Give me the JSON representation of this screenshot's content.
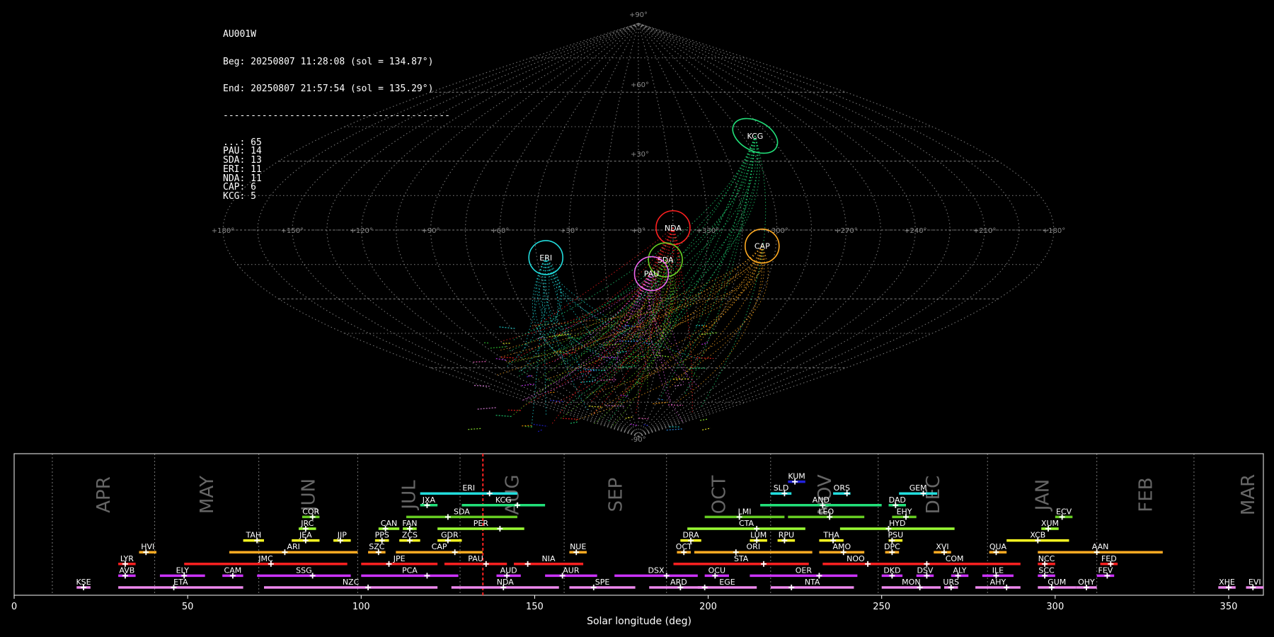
{
  "stats": {
    "station": "AU001W",
    "beg": "Beg: 20250807 11:28:08 (sol = 134.87°)",
    "end": "End: 20250807 21:57:54 (sol = 135.29°)",
    "separator": "-----------------------------------------",
    "counts": [
      {
        "label": "...",
        "value": 65
      },
      {
        "label": "PAU",
        "value": 14
      },
      {
        "label": "SDA",
        "value": 13
      },
      {
        "label": "ERI",
        "value": 11
      },
      {
        "label": "NDA",
        "value": 11
      },
      {
        "label": "CAP",
        "value": 6
      },
      {
        "label": "KCG",
        "value": 5
      }
    ]
  },
  "colors": {
    "grid": "#8a8a8a",
    "frame": "#cfcfcf",
    "month_text": "#666666",
    "current_line": "#ff2020",
    "stream_palette": [
      "#ff2020",
      "#ff9900",
      "#ffff22",
      "#99ff33",
      "#33cc33",
      "#22e07a",
      "#22dddd",
      "#3399ff",
      "#2222dd",
      "#cc33ff",
      "#ff66cc",
      "#ee88ee"
    ]
  },
  "sky_map": {
    "projection": "sinusoidal",
    "lon_ticks": [
      "+180°",
      "+150°",
      "+120°",
      "+90°",
      "+60°",
      "+30°",
      "+0°",
      "+330°",
      "+300°",
      "+270°",
      "+240°",
      "+210°",
      "+180°"
    ],
    "lat_ticks": [
      "+90°",
      "+60°",
      "+30°",
      "-90°"
    ],
    "radiants": [
      {
        "code": "ERI",
        "lon": 41,
        "lat": -12,
        "color": "#22dddd"
      },
      {
        "code": "NDA",
        "lon": 345,
        "lat": 1,
        "color": "#ff2020"
      },
      {
        "code": "SDA",
        "lon": 348,
        "lat": -13,
        "color": "#66cc22"
      },
      {
        "code": "PAU",
        "lon": 354,
        "lat": -19,
        "color": "#ee66ee"
      },
      {
        "code": "CAP",
        "lon": 306,
        "lat": -7,
        "color": "#ffaa22"
      },
      {
        "code": "KCG",
        "lon": 293,
        "lat": 41,
        "color": "#22e07a"
      }
    ]
  },
  "chart_data": {
    "type": "timeline",
    "xlabel": "Solar longitude (deg)",
    "xlim": [
      0,
      360
    ],
    "xticks": [
      0,
      50,
      100,
      150,
      200,
      250,
      300,
      350
    ],
    "current_sol": 135.08,
    "months": [
      {
        "name": "APR",
        "start": 11,
        "end": 40.5
      },
      {
        "name": "MAY",
        "start": 40.5,
        "end": 70.5
      },
      {
        "name": "JUN",
        "start": 70.5,
        "end": 99
      },
      {
        "name": "JUL",
        "start": 99,
        "end": 128.5
      },
      {
        "name": "AUG",
        "start": 128.5,
        "end": 158.5
      },
      {
        "name": "SEP",
        "start": 158.5,
        "end": 188
      },
      {
        "name": "OCT",
        "start": 188,
        "end": 218
      },
      {
        "name": "NOV",
        "start": 218,
        "end": 249
      },
      {
        "name": "DEC",
        "start": 249,
        "end": 280.5
      },
      {
        "name": "JAN",
        "start": 280.5,
        "end": 312
      },
      {
        "name": "FEB",
        "start": 312,
        "end": 340
      },
      {
        "name": "MAR",
        "start": 340,
        "end": 371
      }
    ],
    "streams": [
      {
        "code": "KUM",
        "row": 10,
        "start": 223,
        "end": 228,
        "peak": 225,
        "color": "#2222dd"
      },
      {
        "code": "ERI",
        "row": 9,
        "start": 117,
        "end": 145,
        "peak": 137,
        "color": "#22dddd"
      },
      {
        "code": "SLD",
        "row": 9,
        "start": 218,
        "end": 224,
        "peak": 222,
        "color": "#22dddd"
      },
      {
        "code": "ORS",
        "row": 9,
        "start": 236,
        "end": 241,
        "peak": 240,
        "color": "#22dddd"
      },
      {
        "code": "GEM",
        "row": 9,
        "start": 255,
        "end": 266,
        "peak": 262,
        "color": "#22dddd"
      },
      {
        "code": "JXA",
        "row": 8,
        "start": 117,
        "end": 122,
        "peak": 119,
        "color": "#22e07a"
      },
      {
        "code": "KCG",
        "row": 8,
        "start": 129,
        "end": 153,
        "peak": 145,
        "color": "#22e07a"
      },
      {
        "code": "AND",
        "row": 8,
        "start": 215,
        "end": 250,
        "peak": 233,
        "color": "#22e07a"
      },
      {
        "code": "DAD",
        "row": 8,
        "start": 252,
        "end": 257,
        "peak": 254,
        "color": "#22e07a"
      },
      {
        "code": "COR",
        "row": 7,
        "start": 83,
        "end": 88,
        "peak": 86,
        "color": "#66cc22"
      },
      {
        "code": "SDA",
        "row": 7,
        "start": 113,
        "end": 145,
        "peak": 125,
        "color": "#66cc22"
      },
      {
        "code": "LMI",
        "row": 7,
        "start": 199,
        "end": 222,
        "peak": 209,
        "color": "#66cc22"
      },
      {
        "code": "LEO",
        "row": 7,
        "start": 223,
        "end": 245,
        "peak": 235,
        "color": "#66cc22"
      },
      {
        "code": "EHY",
        "row": 7,
        "start": 253,
        "end": 260,
        "peak": 257,
        "color": "#66cc22"
      },
      {
        "code": "ECV",
        "row": 7,
        "start": 300,
        "end": 305,
        "peak": 302,
        "color": "#66cc22"
      },
      {
        "code": "JRC",
        "row": 6,
        "start": 82,
        "end": 87,
        "peak": 84,
        "color": "#99ff33"
      },
      {
        "code": "CAN",
        "row": 6,
        "start": 105,
        "end": 111,
        "peak": 107,
        "color": "#99ff33"
      },
      {
        "code": "FAN",
        "row": 6,
        "start": 112,
        "end": 116,
        "peak": 114,
        "color": "#99ff33"
      },
      {
        "code": "PER",
        "row": 6,
        "start": 122,
        "end": 147,
        "peak": 140,
        "color": "#99ff33"
      },
      {
        "code": "CTA",
        "row": 6,
        "start": 194,
        "end": 228,
        "peak": 214,
        "color": "#99ff33"
      },
      {
        "code": "HYD",
        "row": 6,
        "start": 238,
        "end": 271,
        "peak": 252,
        "color": "#99ff33"
      },
      {
        "code": "XUM",
        "row": 6,
        "start": 296,
        "end": 301,
        "peak": 298,
        "color": "#99ff33"
      },
      {
        "code": "TAH",
        "row": 5,
        "start": 66,
        "end": 72,
        "peak": 70,
        "color": "#ffff22"
      },
      {
        "code": "JEA",
        "row": 5,
        "start": 80,
        "end": 88,
        "peak": 84,
        "color": "#ffff22"
      },
      {
        "code": "JIP",
        "row": 5,
        "start": 92,
        "end": 97,
        "peak": 94,
        "color": "#ffff22"
      },
      {
        "code": "PPS",
        "row": 5,
        "start": 104,
        "end": 108,
        "peak": 106,
        "color": "#ffff22"
      },
      {
        "code": "ZCS",
        "row": 5,
        "start": 111,
        "end": 117,
        "peak": 114,
        "color": "#ffff22"
      },
      {
        "code": "GDR",
        "row": 5,
        "start": 122,
        "end": 129,
        "peak": 125,
        "color": "#ffff22"
      },
      {
        "code": "DRA",
        "row": 5,
        "start": 192,
        "end": 198,
        "peak": 195,
        "color": "#ffff22"
      },
      {
        "code": "LUM",
        "row": 5,
        "start": 212,
        "end": 217,
        "peak": 214,
        "color": "#ffff22"
      },
      {
        "code": "RPU",
        "row": 5,
        "start": 220,
        "end": 225,
        "peak": 222,
        "color": "#ffff22"
      },
      {
        "code": "THA",
        "row": 5,
        "start": 232,
        "end": 239,
        "peak": 236,
        "color": "#ffff22"
      },
      {
        "code": "PSU",
        "row": 5,
        "start": 252,
        "end": 256,
        "peak": 253,
        "color": "#ffff22"
      },
      {
        "code": "XCB",
        "row": 5,
        "start": 286,
        "end": 304,
        "peak": 295,
        "color": "#ffff22"
      },
      {
        "code": "HVI",
        "row": 4,
        "start": 36,
        "end": 41,
        "peak": 38,
        "color": "#ffaa22"
      },
      {
        "code": "ARI",
        "row": 4,
        "start": 62,
        "end": 99,
        "peak": 78,
        "color": "#ffaa22"
      },
      {
        "code": "SZC",
        "row": 4,
        "start": 102,
        "end": 107,
        "peak": 105,
        "color": "#ffaa22"
      },
      {
        "code": "CAP",
        "row": 4,
        "start": 110,
        "end": 135,
        "peak": 127,
        "color": "#ffaa22"
      },
      {
        "code": "NUE",
        "row": 4,
        "start": 160,
        "end": 165,
        "peak": 162,
        "color": "#ffaa22"
      },
      {
        "code": "OCT",
        "row": 4,
        "start": 191,
        "end": 195,
        "peak": 193,
        "color": "#ffaa22"
      },
      {
        "code": "ORI",
        "row": 4,
        "start": 196,
        "end": 230,
        "peak": 208,
        "color": "#ffaa22"
      },
      {
        "code": "AMO",
        "row": 4,
        "start": 232,
        "end": 245,
        "peak": 239,
        "color": "#ffaa22"
      },
      {
        "code": "DPC",
        "row": 4,
        "start": 251,
        "end": 255,
        "peak": 253,
        "color": "#ffaa22"
      },
      {
        "code": "XVI",
        "row": 4,
        "start": 265,
        "end": 270,
        "peak": 268,
        "color": "#ffaa22"
      },
      {
        "code": "QUA",
        "row": 4,
        "start": 281,
        "end": 286,
        "peak": 283,
        "color": "#ffaa22"
      },
      {
        "code": "AAN",
        "row": 4,
        "start": 295,
        "end": 331,
        "peak": 312,
        "color": "#ffaa22"
      },
      {
        "code": "LYR",
        "row": 3,
        "start": 30,
        "end": 35,
        "peak": 32,
        "color": "#ff2020"
      },
      {
        "code": "JMC",
        "row": 3,
        "start": 49,
        "end": 96,
        "peak": 74,
        "color": "#ff2020"
      },
      {
        "code": "JPE",
        "row": 3,
        "start": 100,
        "end": 122,
        "peak": 108,
        "color": "#ff2020"
      },
      {
        "code": "PAU",
        "row": 3,
        "start": 124,
        "end": 142,
        "peak": 136,
        "color": "#ff2020"
      },
      {
        "code": "NIA",
        "row": 3,
        "start": 144,
        "end": 164,
        "peak": 148,
        "color": "#ff2020"
      },
      {
        "code": "STA",
        "row": 3,
        "start": 190,
        "end": 229,
        "peak": 216,
        "color": "#ff2020"
      },
      {
        "code": "NOO",
        "row": 3,
        "start": 233,
        "end": 252,
        "peak": 246,
        "color": "#ff2020"
      },
      {
        "code": "COM",
        "row": 3,
        "start": 252,
        "end": 290,
        "peak": 263,
        "color": "#ff2020"
      },
      {
        "code": "NCC",
        "row": 3,
        "start": 295,
        "end": 300,
        "peak": 297,
        "color": "#ff2020"
      },
      {
        "code": "FED",
        "row": 3,
        "start": 313,
        "end": 318,
        "peak": 316,
        "color": "#ff2020"
      },
      {
        "code": "AVB",
        "row": 2,
        "start": 30,
        "end": 35,
        "peak": 32,
        "color": "#cc33ff"
      },
      {
        "code": "ELY",
        "row": 2,
        "start": 42,
        "end": 55,
        "peak": 49,
        "color": "#cc33ff"
      },
      {
        "code": "CAM",
        "row": 2,
        "start": 60,
        "end": 66,
        "peak": 63,
        "color": "#cc33ff"
      },
      {
        "code": "SSG",
        "row": 2,
        "start": 70,
        "end": 97,
        "peak": 86,
        "color": "#cc33ff"
      },
      {
        "code": "PCA",
        "row": 2,
        "start": 100,
        "end": 128,
        "peak": 119,
        "color": "#cc33ff"
      },
      {
        "code": "AUD",
        "row": 2,
        "start": 139,
        "end": 146,
        "peak": 142,
        "color": "#cc33ff"
      },
      {
        "code": "AUR",
        "row": 2,
        "start": 153,
        "end": 168,
        "peak": 158,
        "color": "#cc33ff"
      },
      {
        "code": "DSX",
        "row": 2,
        "start": 173,
        "end": 197,
        "peak": 188,
        "color": "#cc33ff"
      },
      {
        "code": "OCU",
        "row": 2,
        "start": 199,
        "end": 206,
        "peak": 202,
        "color": "#cc33ff"
      },
      {
        "code": "OER",
        "row": 2,
        "start": 212,
        "end": 243,
        "peak": 232,
        "color": "#cc33ff"
      },
      {
        "code": "DKD",
        "row": 2,
        "start": 250,
        "end": 256,
        "peak": 253,
        "color": "#cc33ff"
      },
      {
        "code": "DSV",
        "row": 2,
        "start": 260,
        "end": 265,
        "peak": 263,
        "color": "#cc33ff"
      },
      {
        "code": "ALY",
        "row": 2,
        "start": 270,
        "end": 275,
        "peak": 272,
        "color": "#cc33ff"
      },
      {
        "code": "ILE",
        "row": 2,
        "start": 279,
        "end": 288,
        "peak": 283,
        "color": "#cc33ff"
      },
      {
        "code": "SCC",
        "row": 2,
        "start": 295,
        "end": 300,
        "peak": 297,
        "color": "#cc33ff"
      },
      {
        "code": "FEV",
        "row": 2,
        "start": 312,
        "end": 317,
        "peak": 315,
        "color": "#cc33ff"
      },
      {
        "code": "KSE",
        "row": 1,
        "start": 18,
        "end": 22,
        "peak": 20,
        "color": "#ee88ee"
      },
      {
        "code": "ETA",
        "row": 1,
        "start": 30,
        "end": 66,
        "peak": 46,
        "color": "#ee88ee"
      },
      {
        "code": "NZC",
        "row": 1,
        "start": 72,
        "end": 122,
        "peak": 102,
        "color": "#ee88ee"
      },
      {
        "code": "NDA",
        "row": 1,
        "start": 126,
        "end": 157,
        "peak": 141,
        "color": "#ee88ee"
      },
      {
        "code": "SPE",
        "row": 1,
        "start": 160,
        "end": 179,
        "peak": 167,
        "color": "#ee88ee"
      },
      {
        "code": "ARD",
        "row": 1,
        "start": 183,
        "end": 200,
        "peak": 192,
        "color": "#ee88ee"
      },
      {
        "code": "EGE",
        "row": 1,
        "start": 197,
        "end": 214,
        "peak": 199,
        "color": "#ee88ee"
      },
      {
        "code": "NTA",
        "row": 1,
        "start": 218,
        "end": 242,
        "peak": 224,
        "color": "#ee88ee"
      },
      {
        "code": "MON",
        "row": 1,
        "start": 250,
        "end": 267,
        "peak": 261,
        "color": "#ee88ee"
      },
      {
        "code": "URS",
        "row": 1,
        "start": 268,
        "end": 272,
        "peak": 270,
        "color": "#ee88ee"
      },
      {
        "code": "AHY",
        "row": 1,
        "start": 277,
        "end": 290,
        "peak": 286,
        "color": "#ee88ee"
      },
      {
        "code": "GUM",
        "row": 1,
        "start": 295,
        "end": 306,
        "peak": 299,
        "color": "#ee88ee"
      },
      {
        "code": "OHY",
        "row": 1,
        "start": 306,
        "end": 312,
        "peak": 309,
        "color": "#ee88ee"
      },
      {
        "code": "XHE",
        "row": 1,
        "start": 347,
        "end": 352,
        "peak": 350,
        "color": "#ee88ee"
      },
      {
        "code": "EVI",
        "row": 1,
        "start": 355,
        "end": 360,
        "peak": 357,
        "color": "#ee88ee"
      }
    ]
  }
}
